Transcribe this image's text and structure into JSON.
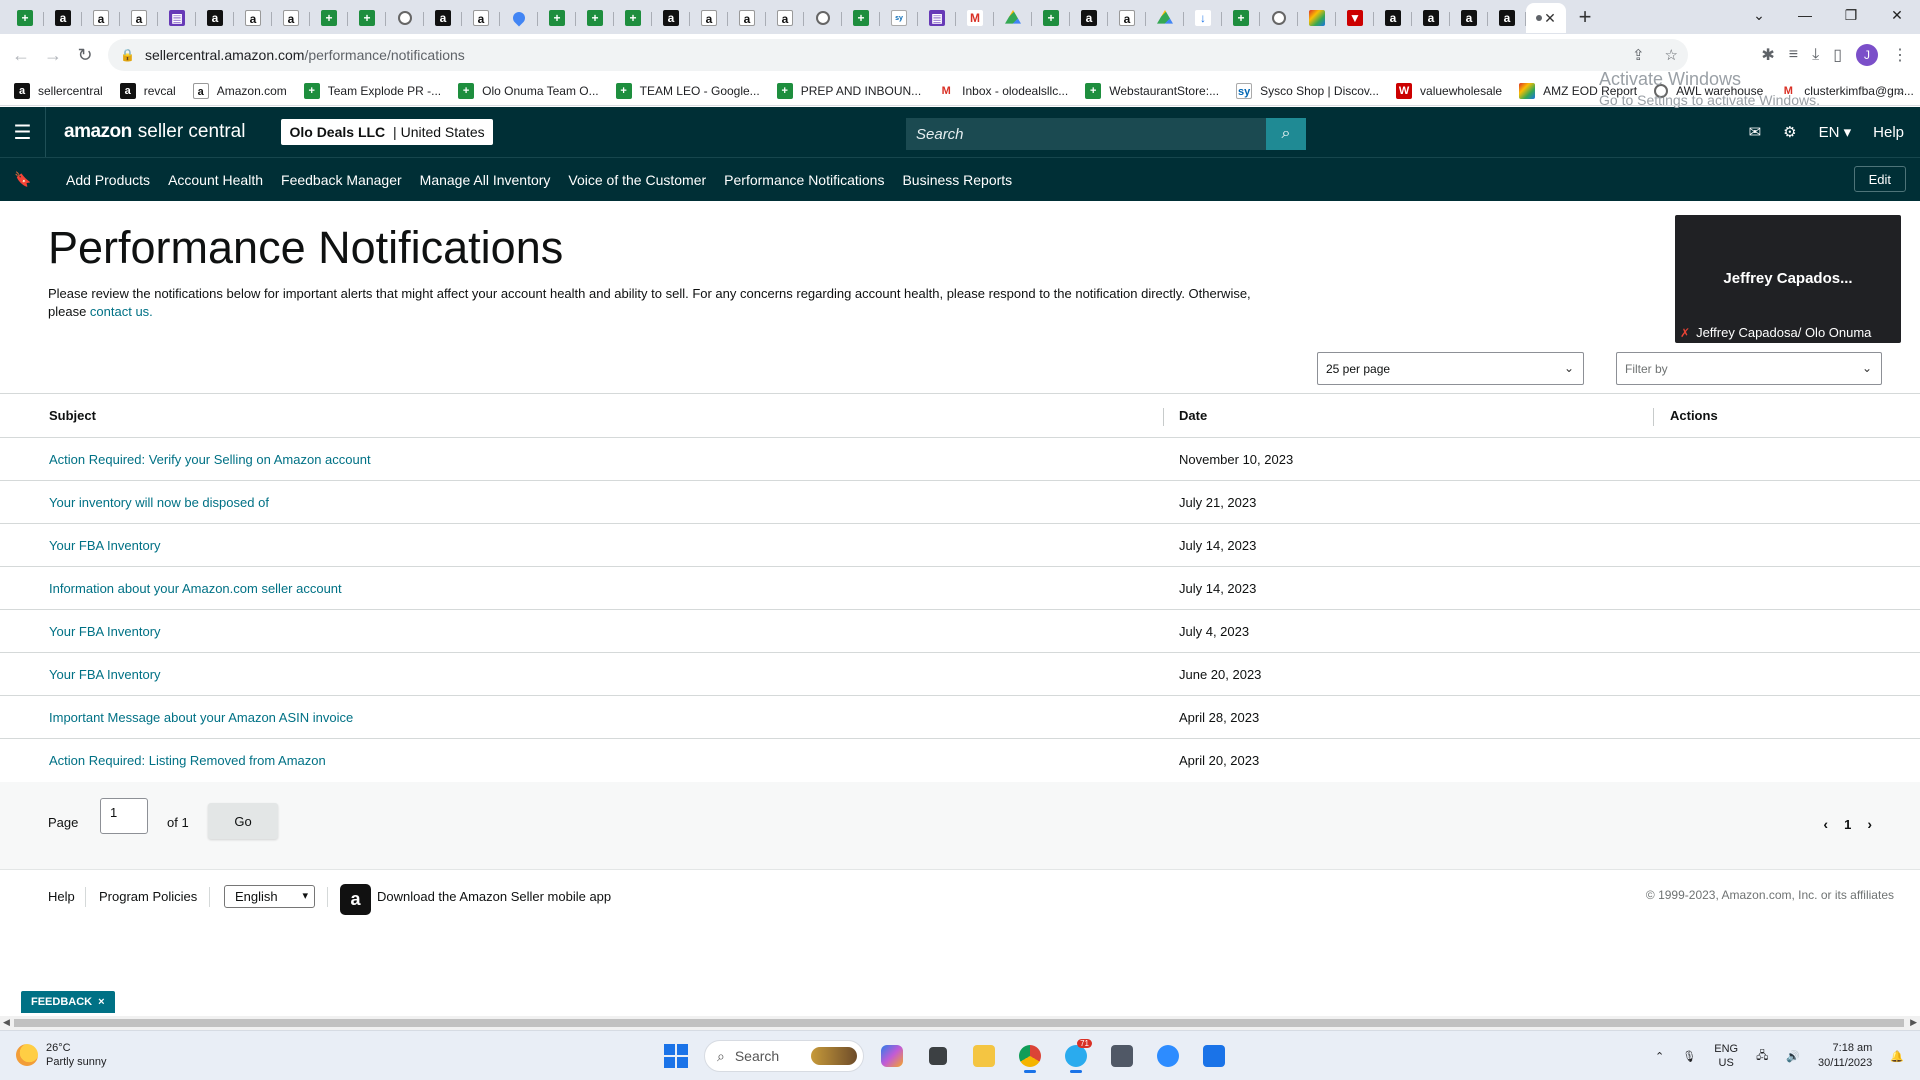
{
  "browser": {
    "tabs_count": 40,
    "new_tab_label": "+",
    "url_host": "sellercentral.amazon.com",
    "url_path": "/performance/notifications",
    "profile_initial": "J",
    "bookmarks": [
      {
        "label": "sellercentral",
        "icon": "amz"
      },
      {
        "label": "revcal",
        "icon": "amz"
      },
      {
        "label": "Amazon.com",
        "icon": "amz2"
      },
      {
        "label": "Team Explode PR -...",
        "icon": "sheet"
      },
      {
        "label": "Olo Onuma Team O...",
        "icon": "sheet"
      },
      {
        "label": "TEAM LEO - Google...",
        "icon": "sheet"
      },
      {
        "label": "PREP AND INBOUN...",
        "icon": "sheet"
      },
      {
        "label": "Inbox - olodealsllc...",
        "icon": "gmail"
      },
      {
        "label": "WebstaurantStore:...",
        "icon": "sheet"
      },
      {
        "label": "Sysco Shop | Discov...",
        "icon": "sysco"
      },
      {
        "label": "valuewholesale",
        "icon": "red"
      },
      {
        "label": "AMZ EOD Report",
        "icon": "multi"
      },
      {
        "label": "AWL warehouse",
        "icon": "globe"
      },
      {
        "label": "clusterkimfba@gm...",
        "icon": "gmail"
      }
    ]
  },
  "header": {
    "logo_bold": "amazon",
    "logo_text": "seller central",
    "account_name": "Olo Deals LLC",
    "account_sep": " | ",
    "account_region": "United States",
    "search_placeholder": "Search",
    "language": "EN",
    "help": "Help"
  },
  "nav": {
    "links": [
      "Add Products",
      "Account Health",
      "Feedback Manager",
      "Manage All Inventory",
      "Voice of the Customer",
      "Performance Notifications",
      "Business Reports"
    ],
    "edit_label": "Edit"
  },
  "page": {
    "title": "Performance Notifications",
    "description": "Please review the notifications below for important alerts that might affect your account health and ability to sell. For any concerns regarding account health, please respond to the notification directly. Otherwise, please ",
    "contact_link": "contact us.",
    "per_page": "25 per page",
    "filter_placeholder": "Filter by"
  },
  "video_overlay": {
    "name": "Jeffrey  Capados...",
    "caption": "Jeffrey Capadosa/ Olo Onuma"
  },
  "table": {
    "headers": {
      "subject": "Subject",
      "date": "Date",
      "actions": "Actions"
    },
    "rows": [
      {
        "subject": "Action Required: Verify your Selling on Amazon account",
        "date": "November 10, 2023"
      },
      {
        "subject": "Your inventory will now be disposed of",
        "date": "July 21, 2023"
      },
      {
        "subject": "Your FBA Inventory",
        "date": "July 14, 2023"
      },
      {
        "subject": "Information about your Amazon.com seller account",
        "date": "July 14, 2023"
      },
      {
        "subject": "Your FBA Inventory",
        "date": "July 4, 2023"
      },
      {
        "subject": "Your FBA Inventory",
        "date": "June 20, 2023"
      },
      {
        "subject": "Important Message about your Amazon ASIN invoice",
        "date": "April 28, 2023"
      },
      {
        "subject": "Action Required: Listing Removed from Amazon",
        "date": "April 20, 2023"
      }
    ]
  },
  "pager": {
    "page_label": "Page",
    "page_value": "1",
    "of_label": "of 1",
    "go_label": "Go",
    "current_page": "1"
  },
  "footer": {
    "help": "Help",
    "program_policies": "Program Policies",
    "language": "English",
    "app_text": "Download the Amazon Seller mobile app",
    "copyright": "© 1999-2023, Amazon.com, Inc. or its affiliates"
  },
  "activate_windows": {
    "line1": "Activate Windows",
    "line2": "Go to Settings to activate Windows."
  },
  "feedback": {
    "label": "FEEDBACK",
    "close": "×"
  },
  "taskbar": {
    "temperature": "26°C",
    "weather": "Partly sunny",
    "search_placeholder": "Search",
    "telegram_badge": "71",
    "lang_line1": "ENG",
    "lang_line2": "US",
    "time": "7:18 am",
    "date": "30/11/2023"
  }
}
